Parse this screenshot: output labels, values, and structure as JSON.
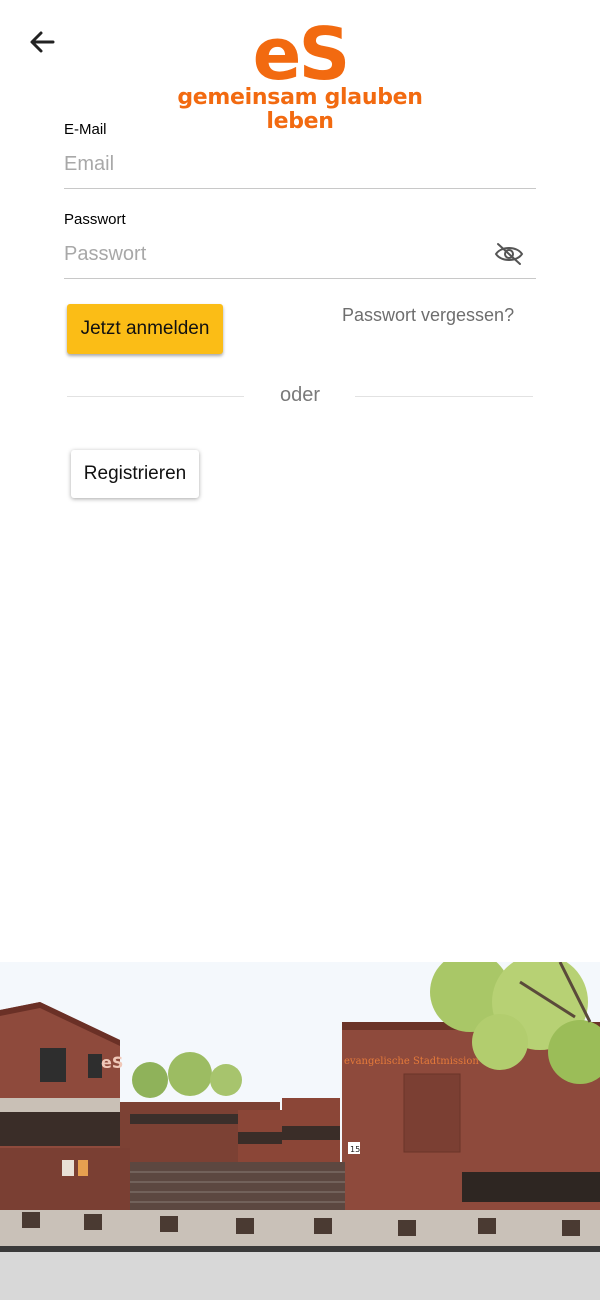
{
  "header": {
    "back_icon": "arrow-left-icon"
  },
  "logo": {
    "mark": "eS",
    "tagline": "gemeinsam glauben leben"
  },
  "form": {
    "email_label": "E-Mail",
    "email_placeholder": "Email",
    "email_value": "",
    "password_label": "Passwort",
    "password_placeholder": "Passwort",
    "password_value": "",
    "password_toggle_icon": "eye-off-icon",
    "login_button": "Jetzt anmelden",
    "forgot_link": "Passwort vergessen?",
    "separator": "oder",
    "register_button": "Registrieren"
  },
  "photo": {
    "building_sign": "evangelische Stadtmission",
    "building_logo": "eS",
    "house_number": "15"
  },
  "colors": {
    "brand_orange": "#F26A10",
    "button_yellow": "#FBBD16",
    "sky": "#F4F8FC",
    "brick": "#8E4A3C"
  }
}
